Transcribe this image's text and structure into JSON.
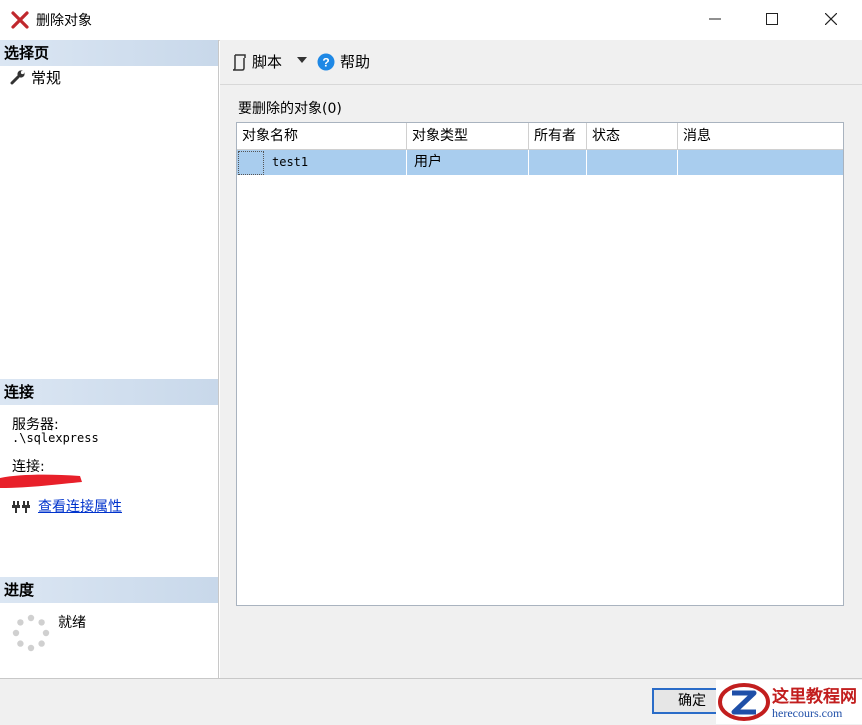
{
  "window": {
    "title": "删除对象",
    "minimize_glyph": "—",
    "maximize_glyph": "☐",
    "close_glyph": "✕"
  },
  "left": {
    "select_page_header": "选择页",
    "nav_items": [
      {
        "label": "常规",
        "icon": "wrench-icon"
      }
    ],
    "connection_header": "连接",
    "server_label": "服务器:",
    "server_value": ".\\sqlexpress",
    "connection_label": "连接:",
    "view_properties_link": "查看连接属性",
    "progress_header": "进度",
    "progress_status": "就绪"
  },
  "toolbar": {
    "script_label": "脚本",
    "help_label": "帮助"
  },
  "grid": {
    "caption": "要删除的对象(0)",
    "columns": [
      "对象名称",
      "对象类型",
      "所有者",
      "状态",
      "消息"
    ],
    "rows": [
      {
        "name": "test1",
        "type": "用户",
        "owner": "",
        "status": "",
        "message": ""
      }
    ]
  },
  "buttons": {
    "ok": "确定"
  },
  "watermark": {
    "brand": "这里教程网",
    "url": "herecours.com"
  },
  "colors": {
    "selection_row": "#a9cdee",
    "header_gradient": "#c8d8ea",
    "link": "#0033cc",
    "title_icon": "#c0282d"
  }
}
